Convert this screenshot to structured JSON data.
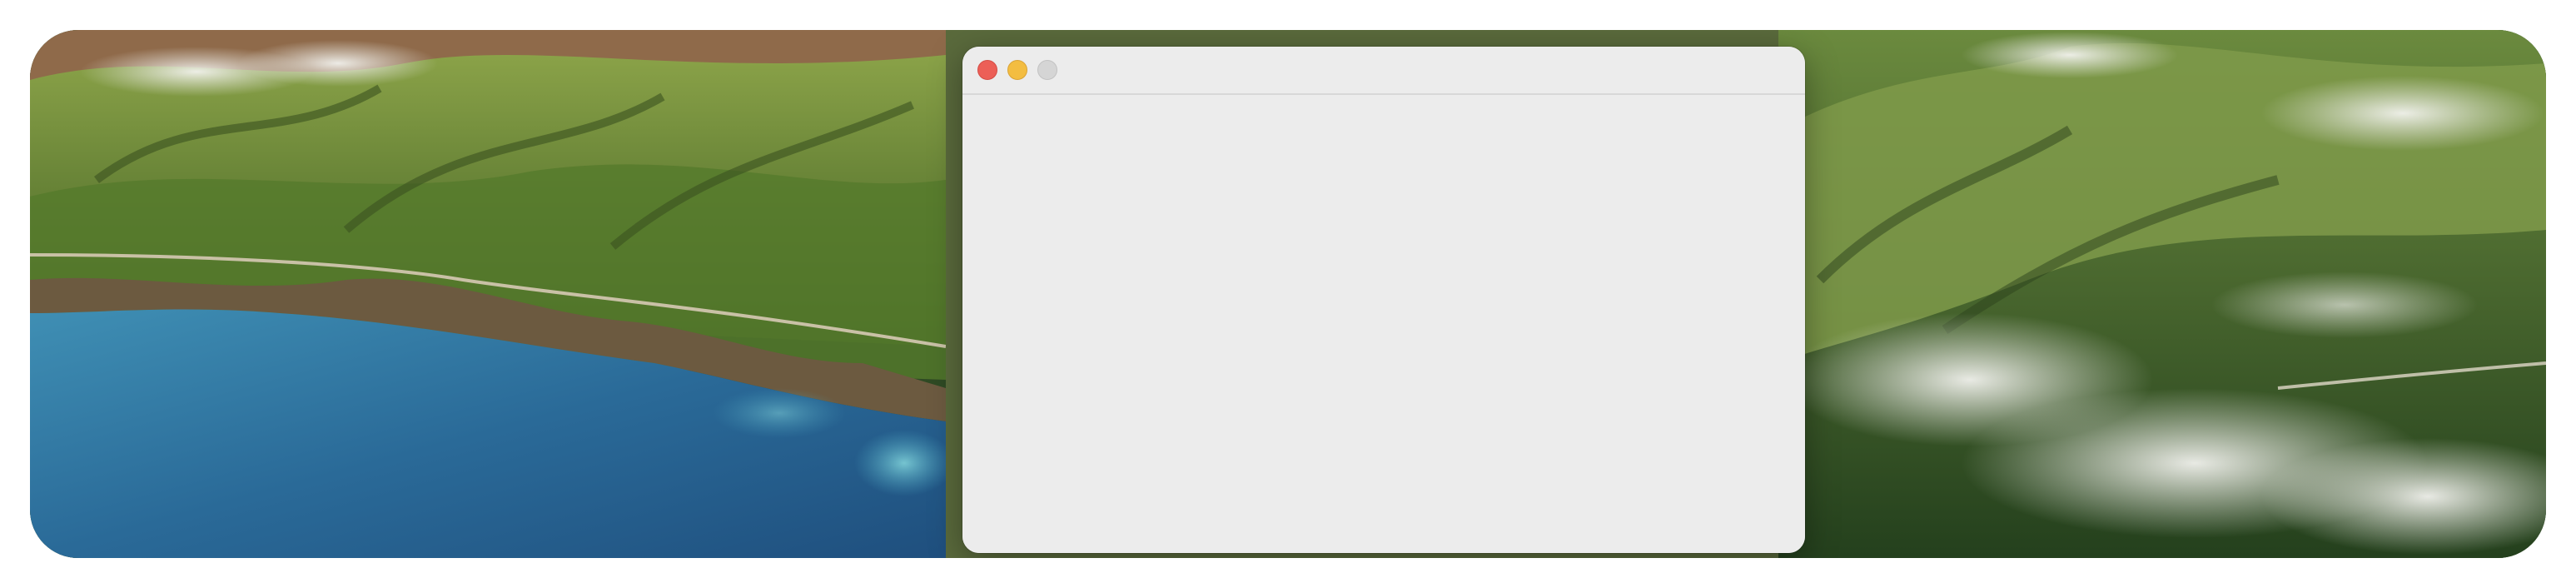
{
  "desktop": {
    "wallpaper_icon": "landscape-wallpaper"
  },
  "window": {
    "title": "",
    "controls": {
      "close_icon": "close-circle",
      "minimize_icon": "minimize-circle",
      "zoom_icon": "zoom-circle-disabled"
    },
    "colors": {
      "close": "#ec5f57",
      "minimize": "#f3bd41",
      "zoom_disabled": "#d5d5d5",
      "background": "#ececec"
    }
  }
}
